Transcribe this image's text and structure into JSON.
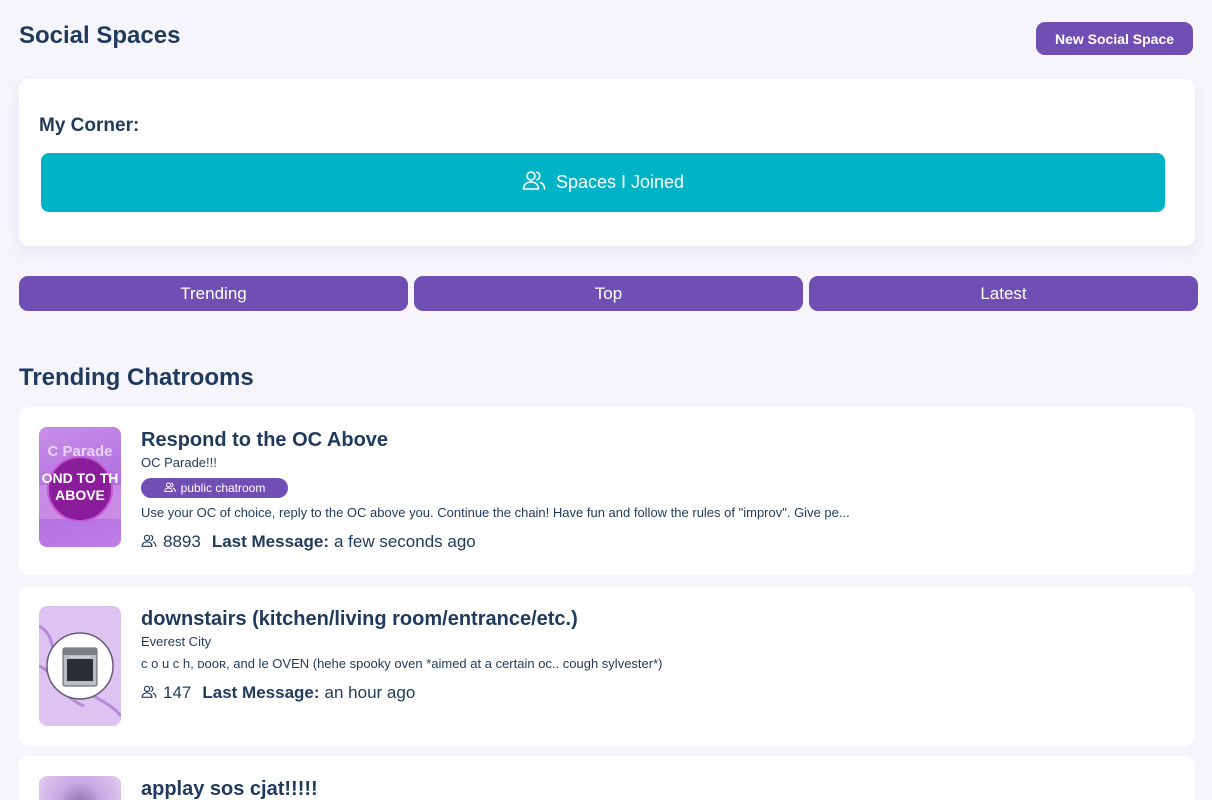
{
  "header": {
    "title": "Social Spaces",
    "new_button": "New Social Space"
  },
  "corner": {
    "label": "My Corner:",
    "joined_button": "Spaces I Joined"
  },
  "tabs": [
    {
      "label": "Trending"
    },
    {
      "label": "Top"
    },
    {
      "label": "Latest"
    }
  ],
  "section_title": "Trending Chatrooms",
  "rooms": [
    {
      "title": "Respond to the OC Above",
      "subtitle": "OC Parade!!!",
      "badge": "public chatroom",
      "description": "Use your OC of choice, reply to the OC above you. Continue the chain! Have fun and follow the rules of \"improv\". Give pe...",
      "members": "8893",
      "last_message_label": "Last Message:",
      "last_message": "a few seconds ago",
      "thumb_text_1": "C Parade",
      "thumb_text_2": "OND TO TH",
      "thumb_text_3": "ABOVE"
    },
    {
      "title": "downstairs (kitchen/living room/entrance/etc.)",
      "subtitle": "Everest City",
      "description": "c o u c h, ᴅᴏᴏʀ, and le OVEN (hehe spooky oven *aimed at a certain oc.. cough sylvester*)",
      "members": "147",
      "last_message_label": "Last Message:",
      "last_message": "an hour ago"
    },
    {
      "title": "applay sos cjat!!!!!"
    }
  ],
  "colors": {
    "accent": "#6f4fb4",
    "cyan": "#00b3c6",
    "text": "#1f3a5c",
    "background": "#f6f5fb"
  },
  "icons": {
    "people": "people-icon"
  }
}
